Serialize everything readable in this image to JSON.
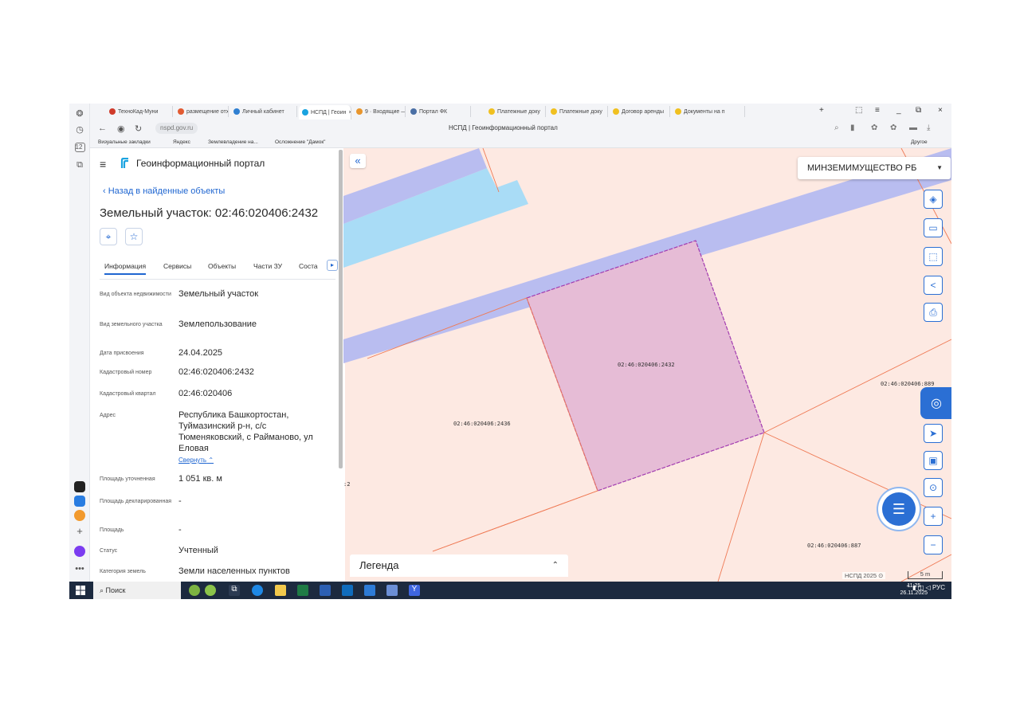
{
  "browser": {
    "tabs": [
      {
        "label": "ТехноКад-Муни",
        "color": "#cf3a2a"
      },
      {
        "label": "размещение отх",
        "color": "#e25b32"
      },
      {
        "label": "Личный кабинет",
        "color": "#2f7fd1"
      },
      {
        "label": "НСПД | Геоин",
        "color": "#1aa3e0",
        "active": true
      },
      {
        "label": "9 · Входящие —",
        "color": "#e8952c"
      },
      {
        "label": "Портал ФК",
        "color": "#4a6fa5"
      },
      {
        "label": "Платежные доку",
        "color": "#f0c020"
      },
      {
        "label": "Платежные доку",
        "color": "#f0c020"
      },
      {
        "label": "Договор аренды",
        "color": "#f0c020"
      },
      {
        "label": "Документы на п",
        "color": "#f0c020"
      }
    ],
    "new_tab": "+",
    "url": "nspd.gov.ru",
    "page_title": "НСПД | Геоинформационный портал",
    "bookmarks": [
      "Визуальные закладки",
      "Яндекс",
      "Землевладение на...",
      "Осложнение \"Дамок\""
    ],
    "other_label": "Другое",
    "sidebar_badge": "12"
  },
  "panel": {
    "portal_name": "Геоинформационный портал",
    "back_link": "Назад в найденные объекты",
    "title": "Земельный участок: 02:46:020406:2432",
    "tabs": [
      "Информация",
      "Сервисы",
      "Объекты",
      "Части ЗУ",
      "Соста"
    ],
    "fields": [
      {
        "label": "Вид объекта недвижимости",
        "value": "Земельный участок"
      },
      {
        "label": "Вид земельного участка",
        "value": "Землепользование"
      },
      {
        "label": "Дата присвоения",
        "value": "24.04.2025"
      },
      {
        "label": "Кадастровый номер",
        "value": "02:46:020406:2432"
      },
      {
        "label": "Кадастровый квартал",
        "value": "02:46:020406"
      },
      {
        "label": "Адрес",
        "value": "Республика Башкортостан, Туймазинский р-н, с/с Тюменяковский, с Райманово, ул Еловая"
      },
      {
        "label": "Площадь уточненная",
        "value": "1 051 кв. м"
      },
      {
        "label": "Площадь декларированная",
        "value": "-"
      },
      {
        "label": "Площадь",
        "value": "-"
      },
      {
        "label": "Статус",
        "value": "Учтенный"
      },
      {
        "label": "Категория земель",
        "value": "Земли населенных пунктов"
      }
    ],
    "collapse_link": "Свернуть"
  },
  "map": {
    "org_selector": "МИНЗЕМИМУЩЕСТВО РБ",
    "legend": "Легенда",
    "credit": "НСПД 2025",
    "scale": "5 m",
    "parcels": [
      {
        "label": "02:46:020406:2432"
      },
      {
        "label": "02:46:020406:2436"
      },
      {
        "label": "02:46:020406:889"
      },
      {
        "label": "02:46:020406:887"
      },
      {
        "label": ":2"
      }
    ],
    "colors": {
      "selected": "#e6bcd6",
      "selected_border": "#a23cb0",
      "parcel_fill": "#fde9e2",
      "parcel_border": "#ef7a55",
      "road": "#b9bdf0",
      "water": "#a9dcf6"
    }
  },
  "taskbar": {
    "search": "Поиск",
    "lang": "РУС",
    "time": "11:25",
    "date": "26.11.2025"
  }
}
